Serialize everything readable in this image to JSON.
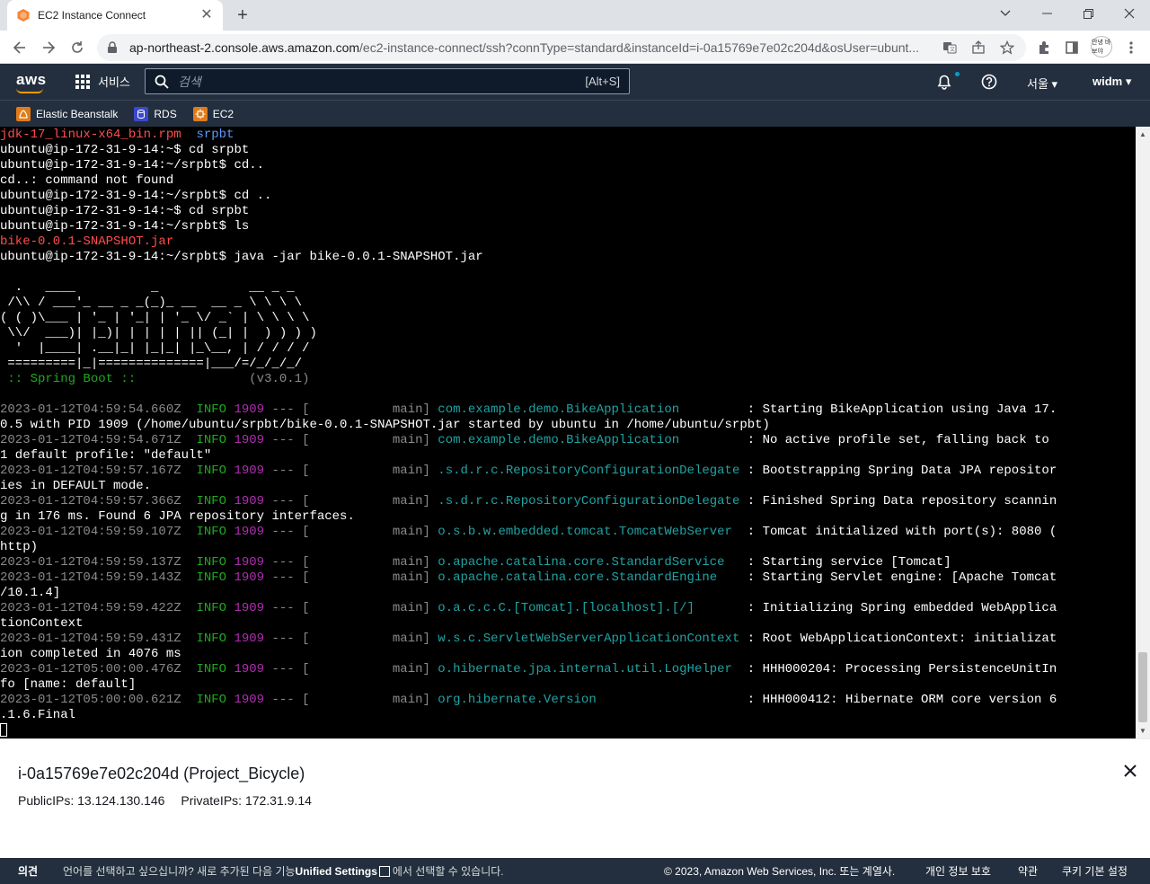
{
  "browser": {
    "tab_title": "EC2 Instance Connect",
    "url_host": "ap-northeast-2.console.aws.amazon.com",
    "url_path": "/ec2-instance-connect/ssh?connType=standard&instanceId=i-0a15769e7e02c204d&osUser=ubunt...",
    "profile_text": "안녕 바보야"
  },
  "aws": {
    "logo": "aws",
    "services_label": "서비스",
    "search_placeholder": "검색",
    "search_shortcut": "[Alt+S]",
    "region": "서울 ▾",
    "user": "widm ▾",
    "favorites": [
      {
        "label": "Elastic Beanstalk",
        "color": "#e07b18"
      },
      {
        "label": "RDS",
        "color": "#3b48cc"
      },
      {
        "label": "EC2",
        "color": "#e07b18"
      }
    ]
  },
  "terminal": {
    "lines": [
      [
        {
          "t": "jdk-17_linux-x64_bin.rpm",
          "c": "red"
        },
        {
          "t": "  ",
          "c": "white"
        },
        {
          "t": "srpbt",
          "c": "blue"
        }
      ],
      [
        {
          "t": "ubuntu@ip-172-31-9-14:~$ cd srpbt",
          "c": "white"
        }
      ],
      [
        {
          "t": "ubuntu@ip-172-31-9-14:~/srpbt$ cd..",
          "c": "white"
        }
      ],
      [
        {
          "t": "cd..: command not found",
          "c": "white"
        }
      ],
      [
        {
          "t": "ubuntu@ip-172-31-9-14:~/srpbt$ cd ..",
          "c": "white"
        }
      ],
      [
        {
          "t": "ubuntu@ip-172-31-9-14:~$ cd srpbt",
          "c": "white"
        }
      ],
      [
        {
          "t": "ubuntu@ip-172-31-9-14:~/srpbt$ ls",
          "c": "white"
        }
      ],
      [
        {
          "t": "bike-0.0.1-SNAPSHOT.jar",
          "c": "red"
        }
      ],
      [
        {
          "t": "ubuntu@ip-172-31-9-14:~/srpbt$ java -jar bike-0.0.1-SNAPSHOT.jar",
          "c": "white"
        }
      ],
      [
        {
          "t": "",
          "c": "white"
        }
      ],
      [
        {
          "t": "  .   ____          _            __ _ _",
          "c": "white"
        }
      ],
      [
        {
          "t": " /\\\\ / ___'_ __ _ _(_)_ __  __ _ \\ \\ \\ \\",
          "c": "white"
        }
      ],
      [
        {
          "t": "( ( )\\___ | '_ | '_| | '_ \\/ _` | \\ \\ \\ \\",
          "c": "white"
        }
      ],
      [
        {
          "t": " \\\\/  ___)| |_)| | | | | || (_| |  ) ) ) )",
          "c": "white"
        }
      ],
      [
        {
          "t": "  '  |____| .__|_| |_|_| |_\\__, | / / / /",
          "c": "white"
        }
      ],
      [
        {
          "t": " =========|_|==============|___/=/_/_/_/",
          "c": "white"
        }
      ],
      [
        {
          "t": " :: Spring Boot :: ",
          "c": "green"
        },
        {
          "t": "              (v3.0.1)",
          "c": "gray"
        }
      ],
      [
        {
          "t": "",
          "c": "white"
        }
      ],
      [
        {
          "t": "2023-01-12T04:59:54.660Z  ",
          "c": "gray"
        },
        {
          "t": "INFO",
          "c": "green"
        },
        {
          "t": " ",
          "c": "white"
        },
        {
          "t": "1909",
          "c": "purple"
        },
        {
          "t": " --- [           main] ",
          "c": "gray"
        },
        {
          "t": "com.example.demo.BikeApplication        ",
          "c": "cyan"
        },
        {
          "t": " : Starting BikeApplication using Java 17.",
          "c": "white"
        }
      ],
      [
        {
          "t": "0.5 with PID 1909 (/home/ubuntu/srpbt/bike-0.0.1-SNAPSHOT.jar started by ubuntu in /home/ubuntu/srpbt)",
          "c": "white"
        }
      ],
      [
        {
          "t": "2023-01-12T04:59:54.671Z  ",
          "c": "gray"
        },
        {
          "t": "INFO",
          "c": "green"
        },
        {
          "t": " ",
          "c": "white"
        },
        {
          "t": "1909",
          "c": "purple"
        },
        {
          "t": " --- [           main] ",
          "c": "gray"
        },
        {
          "t": "com.example.demo.BikeApplication        ",
          "c": "cyan"
        },
        {
          "t": " : No active profile set, falling back to",
          "c": "white"
        }
      ],
      [
        {
          "t": "1 default profile: \"default\"",
          "c": "white"
        }
      ],
      [
        {
          "t": "2023-01-12T04:59:57.167Z  ",
          "c": "gray"
        },
        {
          "t": "INFO",
          "c": "green"
        },
        {
          "t": " ",
          "c": "white"
        },
        {
          "t": "1909",
          "c": "purple"
        },
        {
          "t": " --- [           main] ",
          "c": "gray"
        },
        {
          "t": ".s.d.r.c.RepositoryConfigurationDelegate",
          "c": "cyan"
        },
        {
          "t": " : Bootstrapping Spring Data JPA repositor",
          "c": "white"
        }
      ],
      [
        {
          "t": "ies in DEFAULT mode.",
          "c": "white"
        }
      ],
      [
        {
          "t": "2023-01-12T04:59:57.366Z  ",
          "c": "gray"
        },
        {
          "t": "INFO",
          "c": "green"
        },
        {
          "t": " ",
          "c": "white"
        },
        {
          "t": "1909",
          "c": "purple"
        },
        {
          "t": " --- [           main] ",
          "c": "gray"
        },
        {
          "t": ".s.d.r.c.RepositoryConfigurationDelegate",
          "c": "cyan"
        },
        {
          "t": " : Finished Spring Data repository scannin",
          "c": "white"
        }
      ],
      [
        {
          "t": "g in 176 ms. Found 6 JPA repository interfaces.",
          "c": "white"
        }
      ],
      [
        {
          "t": "2023-01-12T04:59:59.107Z  ",
          "c": "gray"
        },
        {
          "t": "INFO",
          "c": "green"
        },
        {
          "t": " ",
          "c": "white"
        },
        {
          "t": "1909",
          "c": "purple"
        },
        {
          "t": " --- [           main] ",
          "c": "gray"
        },
        {
          "t": "o.s.b.w.embedded.tomcat.TomcatWebServer ",
          "c": "cyan"
        },
        {
          "t": " : Tomcat initialized with port(s): 8080 (",
          "c": "white"
        }
      ],
      [
        {
          "t": "http)",
          "c": "white"
        }
      ],
      [
        {
          "t": "2023-01-12T04:59:59.137Z  ",
          "c": "gray"
        },
        {
          "t": "INFO",
          "c": "green"
        },
        {
          "t": " ",
          "c": "white"
        },
        {
          "t": "1909",
          "c": "purple"
        },
        {
          "t": " --- [           main] ",
          "c": "gray"
        },
        {
          "t": "o.apache.catalina.core.StandardService  ",
          "c": "cyan"
        },
        {
          "t": " : Starting service [Tomcat]",
          "c": "white"
        }
      ],
      [
        {
          "t": "2023-01-12T04:59:59.143Z  ",
          "c": "gray"
        },
        {
          "t": "INFO",
          "c": "green"
        },
        {
          "t": " ",
          "c": "white"
        },
        {
          "t": "1909",
          "c": "purple"
        },
        {
          "t": " --- [           main] ",
          "c": "gray"
        },
        {
          "t": "o.apache.catalina.core.StandardEngine   ",
          "c": "cyan"
        },
        {
          "t": " : Starting Servlet engine: [Apache Tomcat",
          "c": "white"
        }
      ],
      [
        {
          "t": "/10.1.4]",
          "c": "white"
        }
      ],
      [
        {
          "t": "2023-01-12T04:59:59.422Z  ",
          "c": "gray"
        },
        {
          "t": "INFO",
          "c": "green"
        },
        {
          "t": " ",
          "c": "white"
        },
        {
          "t": "1909",
          "c": "purple"
        },
        {
          "t": " --- [           main] ",
          "c": "gray"
        },
        {
          "t": "o.a.c.c.C.[Tomcat].[localhost].[/]      ",
          "c": "cyan"
        },
        {
          "t": " : Initializing Spring embedded WebApplica",
          "c": "white"
        }
      ],
      [
        {
          "t": "tionContext",
          "c": "white"
        }
      ],
      [
        {
          "t": "2023-01-12T04:59:59.431Z  ",
          "c": "gray"
        },
        {
          "t": "INFO",
          "c": "green"
        },
        {
          "t": " ",
          "c": "white"
        },
        {
          "t": "1909",
          "c": "purple"
        },
        {
          "t": " --- [           main] ",
          "c": "gray"
        },
        {
          "t": "w.s.c.ServletWebServerApplicationContext",
          "c": "cyan"
        },
        {
          "t": " : Root WebApplicationContext: initializat",
          "c": "white"
        }
      ],
      [
        {
          "t": "ion completed in 4076 ms",
          "c": "white"
        }
      ],
      [
        {
          "t": "2023-01-12T05:00:00.476Z  ",
          "c": "gray"
        },
        {
          "t": "INFO",
          "c": "green"
        },
        {
          "t": " ",
          "c": "white"
        },
        {
          "t": "1909",
          "c": "purple"
        },
        {
          "t": " --- [           main] ",
          "c": "gray"
        },
        {
          "t": "o.hibernate.jpa.internal.util.LogHelper ",
          "c": "cyan"
        },
        {
          "t": " : HHH000204: Processing PersistenceUnitIn",
          "c": "white"
        }
      ],
      [
        {
          "t": "fo [name: default]",
          "c": "white"
        }
      ],
      [
        {
          "t": "2023-01-12T05:00:00.621Z  ",
          "c": "gray"
        },
        {
          "t": "INFO",
          "c": "green"
        },
        {
          "t": " ",
          "c": "white"
        },
        {
          "t": "1909",
          "c": "purple"
        },
        {
          "t": " --- [           main] ",
          "c": "gray"
        },
        {
          "t": "org.hibernate.Version                   ",
          "c": "cyan"
        },
        {
          "t": " : HHH000412: Hibernate ORM core version 6",
          "c": "white"
        }
      ],
      [
        {
          "t": ".1.6.Final",
          "c": "white"
        }
      ]
    ]
  },
  "instance": {
    "title": "i-0a15769e7e02c204d (Project_Bicycle)",
    "public_ips": "PublicIPs: 13.124.130.146",
    "private_ips": "PrivateIPs: 172.31.9.14"
  },
  "footer": {
    "feedback": "의견",
    "lang_prefix": "언어를 선택하고 싶으십니까? 새로 추가된 다음 기능",
    "lang_link": "Unified Settings",
    "lang_suffix": "에서 선택할 수 있습니다.",
    "copyright": "© 2023, Amazon Web Services, Inc. 또는 계열사.",
    "privacy": "개인 정보 보호",
    "terms": "약관",
    "cookies": "쿠키 기본 설정"
  }
}
